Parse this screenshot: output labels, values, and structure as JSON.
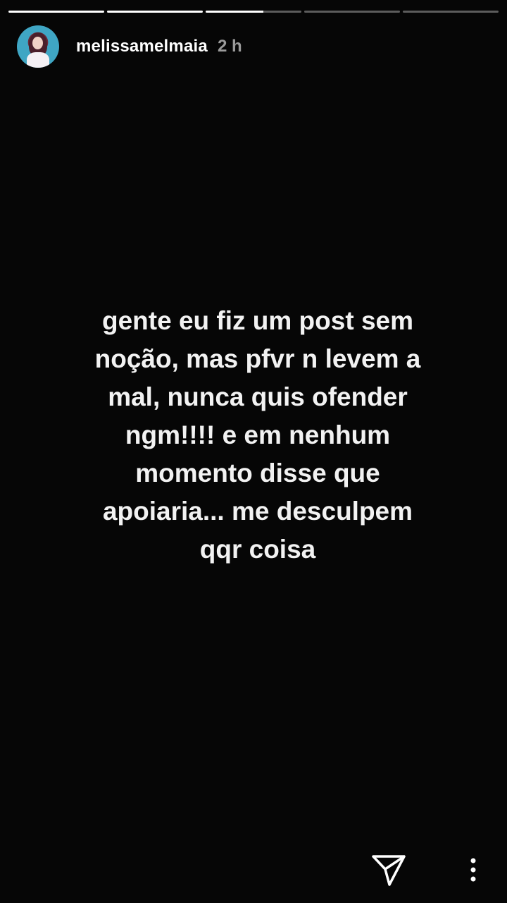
{
  "story": {
    "progress": [
      {
        "fraction": 1.0
      },
      {
        "fraction": 1.0
      },
      {
        "fraction": 0.6
      },
      {
        "fraction": 0.0
      },
      {
        "fraction": 0.0
      }
    ],
    "user": {
      "username": "melissamelmaia",
      "time_ago": "2 h"
    },
    "message": "gente eu fiz um post sem\nnoção, mas pfvr n levem a\nmal, nunca quis ofender\nngm!!!! e em nenhum\nmomento disse que\napoiaria... me desculpem\nqqr coisa",
    "icons": {
      "send": "paper-plane-icon",
      "more": "more-vertical-icon"
    },
    "colors": {
      "background": "#060606",
      "text": "#ffffff"
    }
  }
}
